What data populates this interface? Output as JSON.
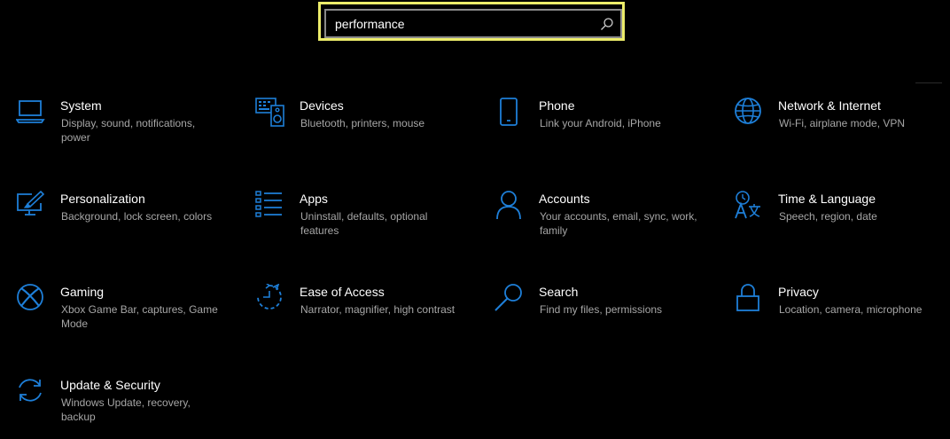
{
  "search": {
    "value": "performance"
  },
  "colors": {
    "accent": "#1e7fd8",
    "highlight": "#ecec6a",
    "background": "#000000"
  },
  "categories": [
    {
      "icon": "laptop-icon",
      "title": "System",
      "desc": "Display, sound, notifications, power"
    },
    {
      "icon": "keyboard-speaker-icon",
      "title": "Devices",
      "desc": "Bluetooth, printers, mouse"
    },
    {
      "icon": "phone-icon",
      "title": "Phone",
      "desc": "Link your Android, iPhone"
    },
    {
      "icon": "globe-icon",
      "title": "Network & Internet",
      "desc": "Wi-Fi, airplane mode, VPN"
    },
    {
      "icon": "paint-monitor-icon",
      "title": "Personalization",
      "desc": "Background, lock screen, colors"
    },
    {
      "icon": "apps-list-icon",
      "title": "Apps",
      "desc": "Uninstall, defaults, optional features"
    },
    {
      "icon": "person-icon",
      "title": "Accounts",
      "desc": "Your accounts, email, sync, work, family"
    },
    {
      "icon": "time-language-icon",
      "title": "Time & Language",
      "desc": "Speech, region, date"
    },
    {
      "icon": "xbox-icon",
      "title": "Gaming",
      "desc": "Xbox Game Bar, captures, Game Mode"
    },
    {
      "icon": "ease-of-access-icon",
      "title": "Ease of Access",
      "desc": "Narrator, magnifier, high contrast"
    },
    {
      "icon": "magnifier-icon",
      "title": "Search",
      "desc": "Find my files, permissions"
    },
    {
      "icon": "lock-icon",
      "title": "Privacy",
      "desc": "Location, camera, microphone"
    },
    {
      "icon": "sync-icon",
      "title": "Update & Security",
      "desc": "Windows Update, recovery, backup"
    }
  ]
}
